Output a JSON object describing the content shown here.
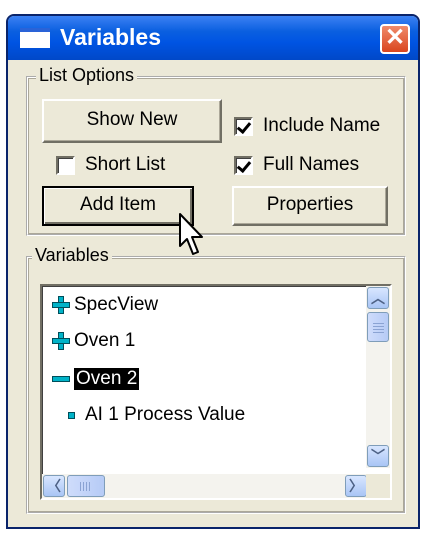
{
  "window": {
    "title": "Variables",
    "close_icon": "close-icon"
  },
  "list_options": {
    "label": "List Options",
    "show_new_label": "Show New",
    "add_item_label": "Add Item",
    "properties_label": "Properties",
    "short_list": {
      "label": "Short List",
      "checked": false
    },
    "include_name": {
      "label": "Include Name",
      "checked": true
    },
    "full_names": {
      "label": "Full Names",
      "checked": true
    }
  },
  "variables": {
    "label": "Variables",
    "items": [
      {
        "label": "SpecView",
        "icon": "expand-plus-icon"
      },
      {
        "label": "Oven 1",
        "icon": "expand-plus-icon"
      },
      {
        "label": "Oven 2",
        "icon": "collapse-minus-icon",
        "selected": true
      },
      {
        "label": "AI 1 Process Value",
        "icon": "leaf-node-icon"
      }
    ]
  },
  "colors": {
    "titlebar": "#0054e3",
    "tree_icon": "#00b3c8",
    "window_bg": "#ece9d8"
  }
}
